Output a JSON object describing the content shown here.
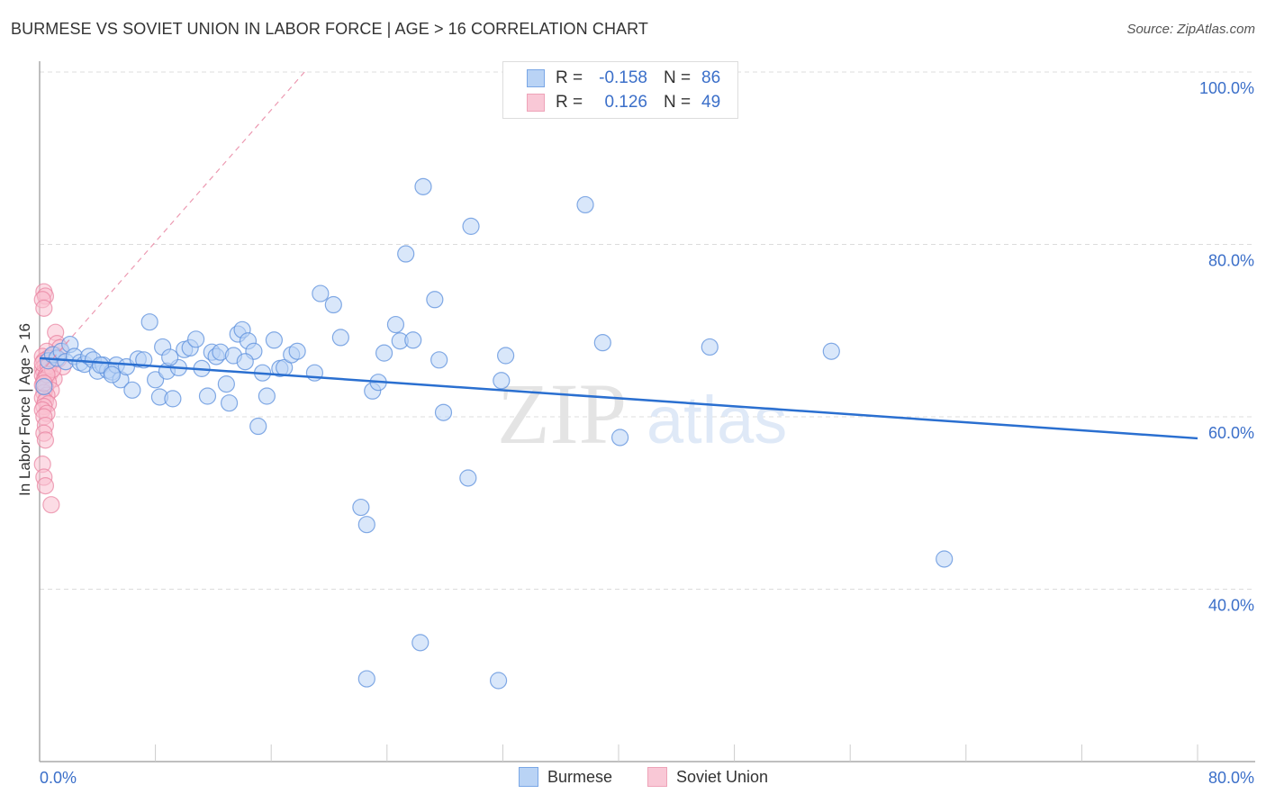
{
  "header": {
    "title": "BURMESE VS SOVIET UNION IN LABOR FORCE | AGE > 16 CORRELATION CHART",
    "source": "Source: ZipAtlas.com"
  },
  "legend": {
    "rows": [
      {
        "r_label": "R =",
        "r_value": "-0.158",
        "n_label": "N =",
        "n_value": "86"
      },
      {
        "r_label": "R =",
        "r_value": "0.126",
        "n_label": "N =",
        "n_value": "49"
      }
    ]
  },
  "bottom_legend": [
    "Burmese",
    "Soviet Union"
  ],
  "watermark": {
    "zip": "ZIP",
    "atlas": "atlas"
  },
  "colors": {
    "burmese_fill": "#b9d3f5",
    "burmese_stroke": "#5b8fdc",
    "burmese_line": "#2a6fd0",
    "soviet_fill": "#f9c0d0",
    "soviet_stroke": "#e8809e",
    "soviet_line": "#e8809e",
    "tick_text": "#3b6fc9"
  },
  "chart_data": {
    "type": "scatter",
    "title": "BURMESE VS SOVIET UNION IN LABOR FORCE | AGE > 16 CORRELATION CHART",
    "xlabel": "",
    "ylabel": "In Labor Force | Age > 16",
    "xlim": [
      0,
      80
    ],
    "ylim": [
      20,
      100
    ],
    "x_tick_labels": [
      "0.0%",
      "80.0%"
    ],
    "y_ticks": [
      40,
      60,
      80,
      100
    ],
    "y_tick_labels": [
      "40.0%",
      "60.0%",
      "80.0%",
      "100.0%"
    ],
    "grid": true,
    "legend_position": "top-center",
    "series": [
      {
        "name": "Burmese",
        "R": -0.158,
        "N": 86,
        "trend": {
          "x": [
            0,
            80
          ],
          "y": [
            66.8,
            57.5
          ]
        },
        "points": [
          [
            0.3,
            63.5
          ],
          [
            0.6,
            66.5
          ],
          [
            0.9,
            67.2
          ],
          [
            1.2,
            66.8
          ],
          [
            1.5,
            67.6
          ],
          [
            1.8,
            66.4
          ],
          [
            2.1,
            68.4
          ],
          [
            2.4,
            67.0
          ],
          [
            2.8,
            66.3
          ],
          [
            3.1,
            66.1
          ],
          [
            3.4,
            67.0
          ],
          [
            3.7,
            66.6
          ],
          [
            4.0,
            65.3
          ],
          [
            4.4,
            66.0
          ],
          [
            4.7,
            65.4
          ],
          [
            5.0,
            65.2
          ],
          [
            5.3,
            66.0
          ],
          [
            5.6,
            64.3
          ],
          [
            6.0,
            65.8
          ],
          [
            6.4,
            63.1
          ],
          [
            6.8,
            66.7
          ],
          [
            7.2,
            66.6
          ],
          [
            7.6,
            71.0
          ],
          [
            8.0,
            64.3
          ],
          [
            8.3,
            62.3
          ],
          [
            8.5,
            68.1
          ],
          [
            8.8,
            65.3
          ],
          [
            9.2,
            62.1
          ],
          [
            9.6,
            65.7
          ],
          [
            10.0,
            67.8
          ],
          [
            10.4,
            68.0
          ],
          [
            10.8,
            69.0
          ],
          [
            11.2,
            65.6
          ],
          [
            11.6,
            62.4
          ],
          [
            11.9,
            67.5
          ],
          [
            12.2,
            67.0
          ],
          [
            12.5,
            67.5
          ],
          [
            12.9,
            63.8
          ],
          [
            13.1,
            61.6
          ],
          [
            13.4,
            67.1
          ],
          [
            13.7,
            69.6
          ],
          [
            14.0,
            70.1
          ],
          [
            14.4,
            68.8
          ],
          [
            14.8,
            67.6
          ],
          [
            15.1,
            58.9
          ],
          [
            15.4,
            65.1
          ],
          [
            15.7,
            62.4
          ],
          [
            16.2,
            68.9
          ],
          [
            16.6,
            65.6
          ],
          [
            16.9,
            65.7
          ],
          [
            17.4,
            67.2
          ],
          [
            17.8,
            67.6
          ],
          [
            19.0,
            65.1
          ],
          [
            19.4,
            74.3
          ],
          [
            20.3,
            73.0
          ],
          [
            20.8,
            69.2
          ],
          [
            22.2,
            49.5
          ],
          [
            22.6,
            47.5
          ],
          [
            23.0,
            63.0
          ],
          [
            23.4,
            64.0
          ],
          [
            23.8,
            67.4
          ],
          [
            24.6,
            70.7
          ],
          [
            24.9,
            68.8
          ],
          [
            25.3,
            78.9
          ],
          [
            25.8,
            68.9
          ],
          [
            26.5,
            86.7
          ],
          [
            27.3,
            73.6
          ],
          [
            27.6,
            66.6
          ],
          [
            27.9,
            60.5
          ],
          [
            26.3,
            33.8
          ],
          [
            22.6,
            29.6
          ],
          [
            29.6,
            52.9
          ],
          [
            29.8,
            82.1
          ],
          [
            31.7,
            29.4
          ],
          [
            31.9,
            64.2
          ],
          [
            32.2,
            67.1
          ],
          [
            37.7,
            84.6
          ],
          [
            38.9,
            68.6
          ],
          [
            40.1,
            57.6
          ],
          [
            46.3,
            68.1
          ],
          [
            54.7,
            67.6
          ],
          [
            62.5,
            43.5
          ],
          [
            4.2,
            66.0
          ],
          [
            9.0,
            66.9
          ],
          [
            14.2,
            66.4
          ],
          [
            5.0,
            64.9
          ]
        ]
      },
      {
        "name": "Soviet Union",
        "R": 0.126,
        "N": 49,
        "trend": {
          "x": [
            0,
            18.3
          ],
          "y": [
            65.0,
            100.0
          ]
        },
        "points": [
          [
            0.3,
            74.5
          ],
          [
            0.4,
            74.0
          ],
          [
            0.2,
            73.6
          ],
          [
            0.3,
            72.6
          ],
          [
            1.1,
            69.8
          ],
          [
            1.2,
            68.5
          ],
          [
            1.4,
            68.0
          ],
          [
            0.5,
            67.6
          ],
          [
            1.0,
            67.2
          ],
          [
            0.2,
            67.0
          ],
          [
            0.6,
            66.8
          ],
          [
            0.3,
            66.5
          ],
          [
            0.8,
            66.3
          ],
          [
            0.4,
            66.0
          ],
          [
            1.6,
            65.8
          ],
          [
            0.2,
            65.6
          ],
          [
            0.5,
            65.4
          ],
          [
            0.3,
            65.2
          ],
          [
            0.7,
            65.0
          ],
          [
            0.2,
            64.8
          ],
          [
            0.4,
            64.6
          ],
          [
            1.0,
            64.4
          ],
          [
            0.3,
            64.2
          ],
          [
            0.6,
            64.0
          ],
          [
            0.2,
            63.7
          ],
          [
            0.4,
            63.4
          ],
          [
            0.8,
            63.1
          ],
          [
            0.3,
            62.8
          ],
          [
            0.5,
            62.5
          ],
          [
            0.2,
            62.2
          ],
          [
            0.4,
            61.8
          ],
          [
            0.6,
            61.5
          ],
          [
            0.3,
            61.2
          ],
          [
            0.2,
            60.8
          ],
          [
            0.5,
            60.4
          ],
          [
            0.3,
            60.0
          ],
          [
            0.4,
            59.0
          ],
          [
            0.3,
            58.1
          ],
          [
            0.4,
            57.3
          ],
          [
            0.2,
            54.5
          ],
          [
            0.3,
            53.0
          ],
          [
            0.4,
            52.0
          ],
          [
            0.8,
            49.8
          ],
          [
            0.2,
            66.2
          ],
          [
            0.6,
            65.9
          ],
          [
            1.3,
            66.7
          ],
          [
            0.9,
            65.5
          ],
          [
            0.5,
            64.9
          ],
          [
            0.3,
            63.9
          ]
        ]
      }
    ]
  }
}
